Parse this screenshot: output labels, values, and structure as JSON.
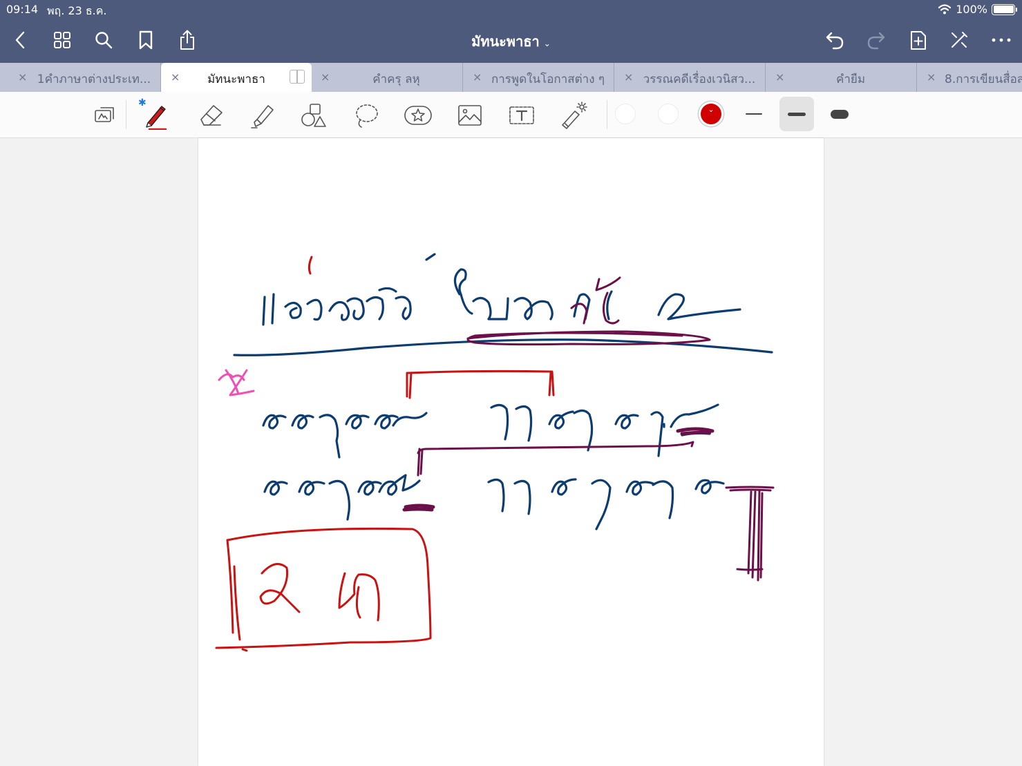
{
  "status_bar": {
    "time": "09:14",
    "date": "พฤ. 23 ธ.ค.",
    "battery_text": "100%",
    "battery_level": 1.0
  },
  "nav": {
    "document_title": "มัทนะพาธา",
    "title_chevron": "⌄",
    "icons": [
      "back-icon",
      "grid-icon",
      "search-icon",
      "bookmark-icon",
      "share-icon",
      "undo-icon",
      "redo-icon",
      "add-page-icon",
      "close-pencil-icon",
      "more-icon"
    ]
  },
  "tabs": [
    {
      "label": "1คำภาษาต่างประเท...",
      "active": false
    },
    {
      "label": "มัทนะพาธา",
      "active": true
    },
    {
      "label": "คำครุ ลหุ",
      "active": false
    },
    {
      "label": "การพูดในโอกาสต่าง ๆ",
      "active": false
    },
    {
      "label": "วรรณคดีเรื่องเวนิสว...",
      "active": false
    },
    {
      "label": "คำยืม",
      "active": false
    },
    {
      "label": "8.การเขียนสื่อส",
      "active": false
    }
  ],
  "tab_close_glyph": "×",
  "toolbar": {
    "tools": [
      "read-mode-icon",
      "pen-icon",
      "eraser-icon",
      "highlighter-icon",
      "shapes-icon",
      "lasso-icon",
      "elements-icon",
      "image-icon",
      "text-icon",
      "laser-pointer-icon"
    ],
    "selected_tool": "pen-icon",
    "bluetooth_glyph": "✱",
    "colors": [
      "#ffffff",
      "#ffffff",
      "#d10000"
    ],
    "selected_color": "#d10000",
    "stroke_widths": [
      "thin",
      "medium",
      "thick"
    ],
    "selected_width": "medium"
  },
  "ink_colors": {
    "blue": "#0d3d70",
    "red": "#cc1111",
    "purple": "#6b1048",
    "pink": "#f04fb4"
  }
}
